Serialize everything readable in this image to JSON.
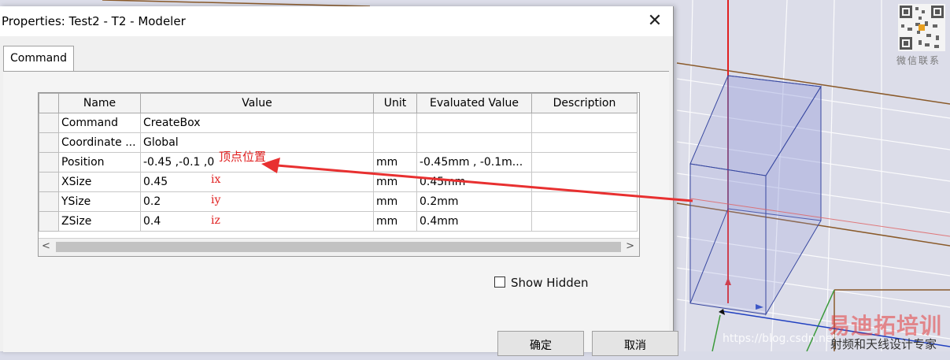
{
  "dialog": {
    "title": "Properties: Test2 - T2 - Modeler",
    "close_glyph": "✕",
    "tab_label": "Command"
  },
  "grid": {
    "columns": [
      "Name",
      "Value",
      "Unit",
      "Evaluated Value",
      "Description"
    ],
    "rows": [
      {
        "name": "Command",
        "value": "CreateBox",
        "unit": "",
        "evaluated": "",
        "description": ""
      },
      {
        "name": "Coordinate ...",
        "value": "Global",
        "unit": "",
        "evaluated": "",
        "description": ""
      },
      {
        "name": "Position",
        "value": "-0.45 ,-0.1 ,0",
        "unit": "mm",
        "evaluated": "-0.45mm , -0.1m...",
        "description": ""
      },
      {
        "name": "XSize",
        "value": "0.45",
        "unit": "mm",
        "evaluated": "0.45mm",
        "description": ""
      },
      {
        "name": "YSize",
        "value": "0.2",
        "unit": "mm",
        "evaluated": "0.2mm",
        "description": ""
      },
      {
        "name": "ZSize",
        "value": "0.4",
        "unit": "mm",
        "evaluated": "0.4mm",
        "description": ""
      }
    ],
    "scroll_left": "<",
    "scroll_right": ">"
  },
  "annotations": {
    "vertex": "顶点位置",
    "ix": "ix",
    "iy": "iy",
    "iz": "iz",
    "color": "#e02020"
  },
  "options": {
    "show_hidden_label": "Show Hidden"
  },
  "buttons": {
    "ok_label": "确定",
    "cancel_label": "取消"
  },
  "watermark": {
    "qr_caption": "微信联系",
    "brand": "易迪拓培训",
    "subtitle": "射频和天线设计专家",
    "url": "https://blog.csdn.net"
  }
}
